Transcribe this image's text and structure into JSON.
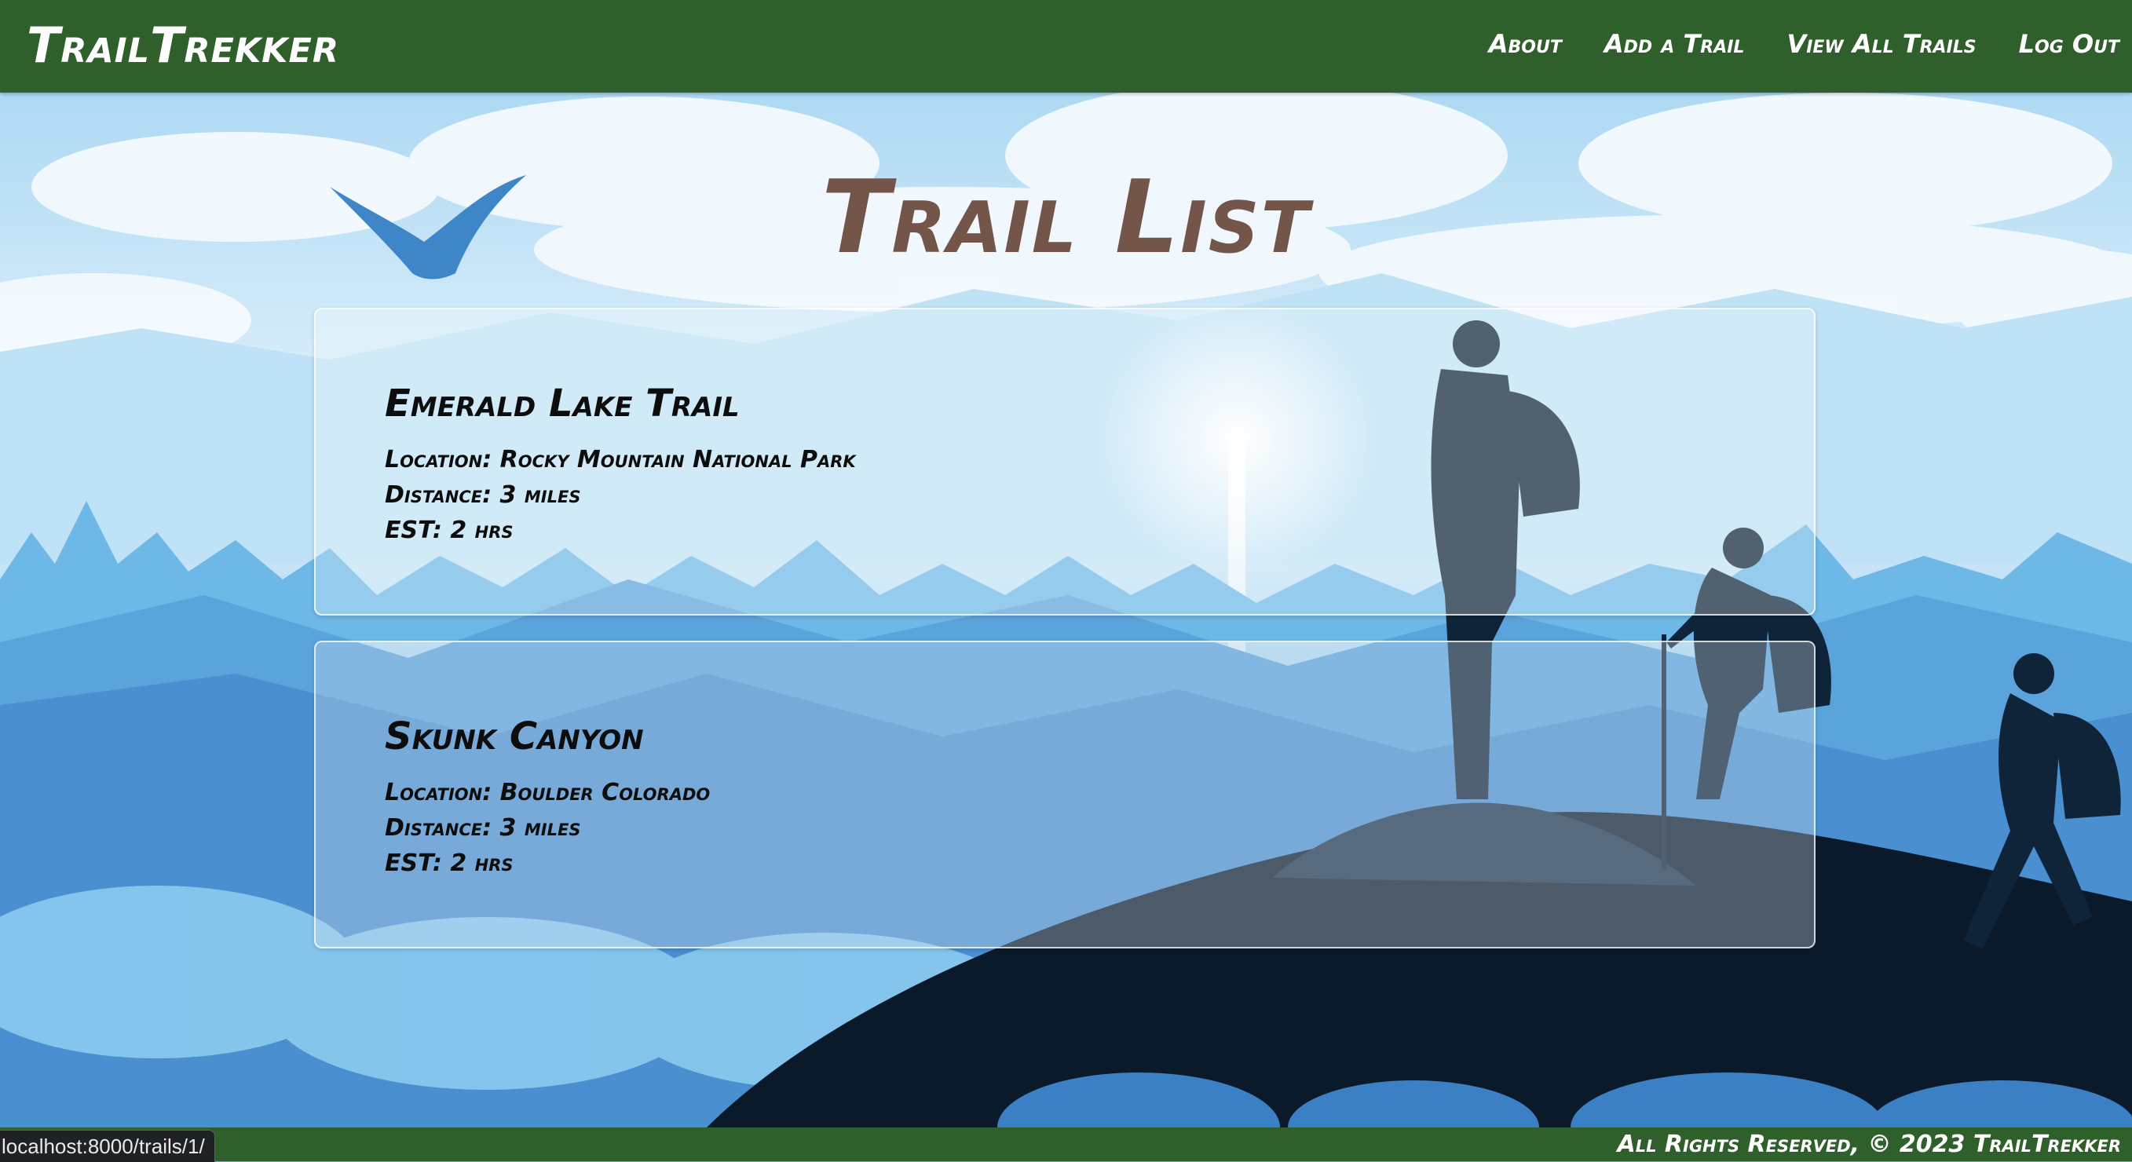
{
  "app": {
    "brand": "TrailTrekker"
  },
  "nav": {
    "links": [
      {
        "label": "About"
      },
      {
        "label": "Add a Trail"
      },
      {
        "label": "View All Trails"
      },
      {
        "label": "Log Out"
      }
    ]
  },
  "main": {
    "title": "Trail List",
    "trails": [
      {
        "name": "Emerald Lake Trail",
        "location": "Location: Rocky Mountain National Park",
        "distance": "Distance: 3 miles",
        "est": "EST: 2 hrs"
      },
      {
        "name": "Skunk Canyon",
        "location": "Location: Boulder Colorado",
        "distance": "Distance: 3 miles",
        "est": "EST: 2 hrs"
      }
    ]
  },
  "footer": {
    "text": "All Rights Reserved, © 2023 TrailTrekker"
  },
  "status_bar": {
    "url": "localhost:8000/trails/1/"
  },
  "colors": {
    "nav_background": "#2f5f2a",
    "title_color": "#74554a",
    "text_color": "#0d0d0d",
    "sky_light": "#e9f5fc",
    "sky_mid": "#7dc4ec",
    "silhouette_dark": "#0b1a2b"
  }
}
